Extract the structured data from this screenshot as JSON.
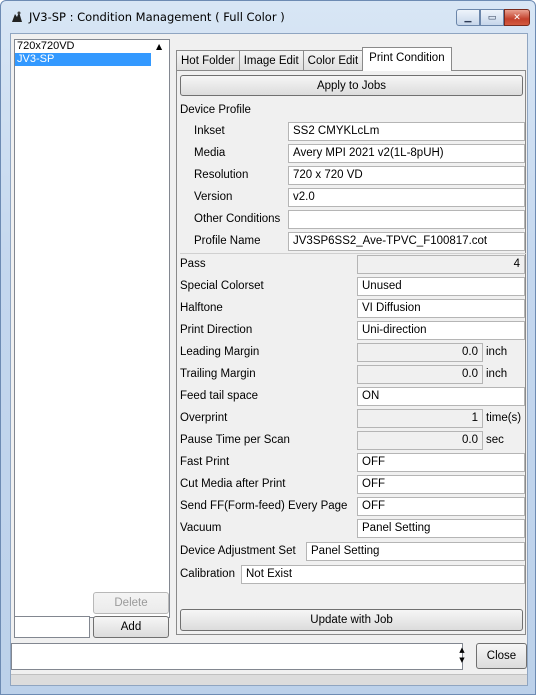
{
  "window": {
    "title": "JV3-SP : Condition Management ( Full Color )"
  },
  "list": {
    "items": [
      "720x720VD",
      "JV3-SP"
    ],
    "selected_index": 1,
    "delete_label": "Delete",
    "add_label": "Add",
    "add_value": ""
  },
  "tabs": [
    {
      "label": "Hot Folder"
    },
    {
      "label": "Image Edit"
    },
    {
      "label": "Color Edit"
    },
    {
      "label": "Print Condition"
    }
  ],
  "print_condition": {
    "apply_label": "Apply to Jobs",
    "device_profile_label": "Device Profile",
    "inkset_label": "Inkset",
    "inkset_value": "SS2 CMYKLcLm",
    "media_label": "Media",
    "media_value": "Avery MPI 2021 v2(1L-8pUH)",
    "resolution_label": "Resolution",
    "resolution_value": "720 x 720 VD",
    "version_label": "Version",
    "version_value": "v2.0",
    "other_label": "Other Conditions",
    "other_value": "",
    "profile_name_label": "Profile Name",
    "profile_name_value": "JV3SP6SS2_Ave-TPVC_F100817.cot",
    "pass_label": "Pass",
    "pass_value": "4",
    "special_colorset_label": "Special Colorset",
    "special_colorset_value": "Unused",
    "halftone_label": "Halftone",
    "halftone_value": "VI Diffusion",
    "print_direction_label": "Print Direction",
    "print_direction_value": "Uni-direction",
    "leading_margin_label": "Leading Margin",
    "leading_margin_value": "0.0",
    "leading_margin_unit": "inch",
    "trailing_margin_label": "Trailing Margin",
    "trailing_margin_value": "0.0",
    "trailing_margin_unit": "inch",
    "feed_tail_label": "Feed tail space",
    "feed_tail_value": "ON",
    "overprint_label": "Overprint",
    "overprint_value": "1",
    "overprint_unit": "time(s)",
    "pause_label": "Pause Time per Scan",
    "pause_value": "0.0",
    "pause_unit": "sec",
    "fast_print_label": "Fast Print",
    "fast_print_value": "OFF",
    "cut_media_label": "Cut Media after Print",
    "cut_media_value": "OFF",
    "send_ff_label": "Send FF(Form-feed) Every Page",
    "send_ff_value": "OFF",
    "vacuum_label": "Vacuum",
    "vacuum_value": "Panel Setting",
    "device_adjust_label": "Device Adjustment Set",
    "device_adjust_value": "Panel Setting",
    "calibration_label": "Calibration",
    "calibration_value": "Not Exist",
    "update_label": "Update with Job"
  },
  "footer": {
    "status_value": "",
    "close_label": "Close"
  }
}
